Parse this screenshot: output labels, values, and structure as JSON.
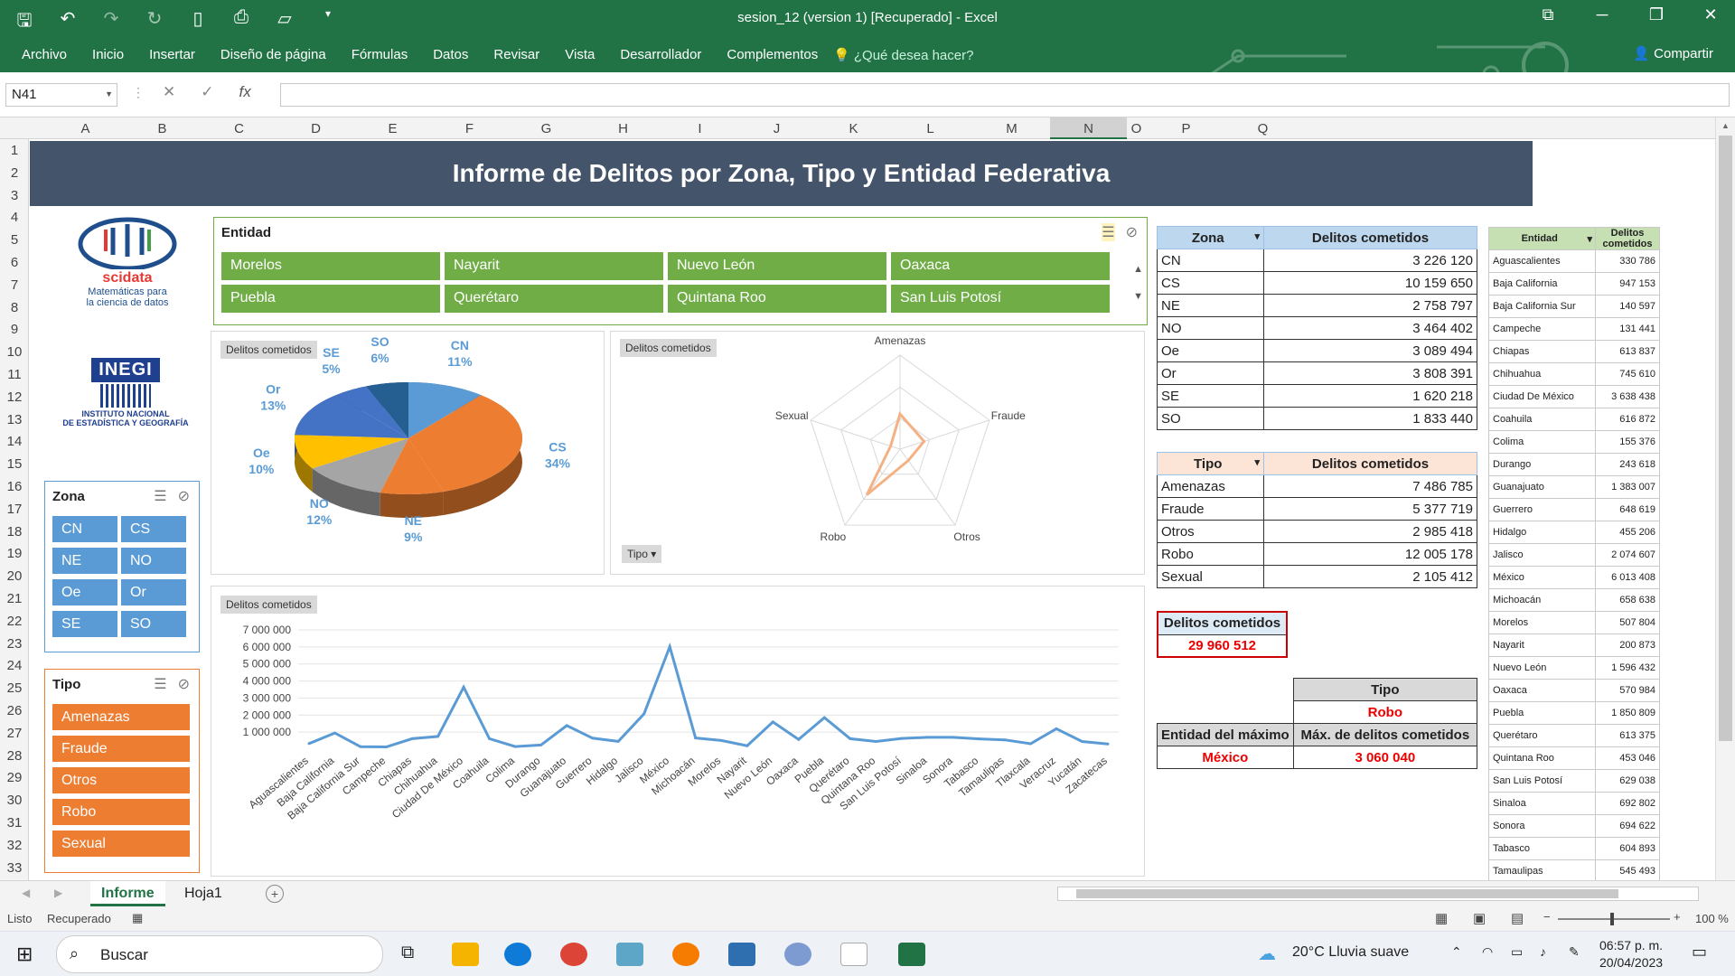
{
  "window": {
    "title": "sesion_12 (version 1) [Recuperado] - Excel"
  },
  "menu": {
    "items": [
      "Archivo",
      "Inicio",
      "Insertar",
      "Diseño de página",
      "Fórmulas",
      "Datos",
      "Revisar",
      "Vista",
      "Desarrollador",
      "Complementos"
    ],
    "tell_me": "¿Qué desea hacer?",
    "share": "Compartir"
  },
  "formula_bar": {
    "name_box": "N41",
    "fx": "fx",
    "value": ""
  },
  "columns": [
    "A",
    "B",
    "C",
    "D",
    "E",
    "F",
    "G",
    "H",
    "I",
    "J",
    "K",
    "L",
    "M",
    "N",
    "O",
    "P",
    "Q"
  ],
  "rows": [
    "1",
    "2",
    "3",
    "4",
    "5",
    "6",
    "7",
    "8",
    "9",
    "10",
    "11",
    "12",
    "13",
    "14",
    "15",
    "16",
    "17",
    "18",
    "19",
    "20",
    "21",
    "22",
    "23",
    "24",
    "25",
    "26",
    "27",
    "28",
    "29",
    "30",
    "31",
    "32",
    "33"
  ],
  "banner": {
    "title": "Informe de Delitos por Zona, Tipo y Entidad Federativa"
  },
  "logos": {
    "scidata_name": "scidata",
    "scidata_tagline_1": "Matemáticas para",
    "scidata_tagline_2": "la ciencia de datos",
    "inegi_name": "INEGI",
    "inegi_line_1": "INSTITUTO NACIONAL",
    "inegi_line_2": "DE ESTADÍSTICA Y GEOGRAFÍA"
  },
  "slicers": {
    "entidad": {
      "title": "Entidad",
      "items": [
        "Morelos",
        "Nayarit",
        "Nuevo León",
        "Oaxaca",
        "Puebla",
        "Querétaro",
        "Quintana Roo",
        "San Luis Potosí"
      ]
    },
    "zona": {
      "title": "Zona",
      "items": [
        "CN",
        "CS",
        "NE",
        "NO",
        "Oe",
        "Or",
        "SE",
        "SO"
      ]
    },
    "tipo": {
      "title": "Tipo",
      "items": [
        "Amenazas",
        "Fraude",
        "Otros",
        "Robo",
        "Sexual"
      ]
    }
  },
  "chart_labels": {
    "pie": "Delitos cometidos",
    "radar": "Delitos cometidos",
    "line": "Delitos cometidos",
    "radar_filter": "Tipo"
  },
  "chart_data": [
    {
      "type": "pie",
      "categories": [
        "CN",
        "CS",
        "NE",
        "NO",
        "Oe",
        "Or",
        "SE",
        "SO"
      ],
      "values": [
        11,
        34,
        9,
        12,
        10,
        13,
        5,
        6
      ],
      "labels": [
        "11%",
        "34%",
        "9%",
        "12%",
        "10%",
        "13%",
        "5%",
        "6%"
      ],
      "colors": [
        "#5b9bd5",
        "#ed7d31",
        "#ed7d31",
        "#a5a5a5",
        "#ffc000",
        "#4472c4",
        "#4472c4",
        "#255e91"
      ]
    },
    {
      "type": "radar",
      "categories": [
        "Amenazas",
        "Fraude",
        "Otros",
        "Robo",
        "Sexual"
      ],
      "values": [
        7486785,
        5377719,
        2985418,
        12005178,
        2105412
      ],
      "rmax": 20000000
    },
    {
      "type": "line",
      "categories": [
        "Aguascalientes",
        "Baja California",
        "Baja California Sur",
        "Campeche",
        "Chiapas",
        "Chihuahua",
        "Ciudad De México",
        "Coahuila",
        "Colima",
        "Durango",
        "Guanajuato",
        "Guerrero",
        "Hidalgo",
        "Jalisco",
        "México",
        "Michoacán",
        "Morelos",
        "Nayarit",
        "Nuevo León",
        "Oaxaca",
        "Puebla",
        "Querétaro",
        "Quintana Roo",
        "San Luis Potosí",
        "Sinaloa",
        "Sonora",
        "Tabasco",
        "Tamaulipas",
        "Tlaxcala",
        "Veracruz",
        "Yucatán",
        "Zacatecas"
      ],
      "values": [
        330786,
        947153,
        140597,
        131441,
        613837,
        745610,
        3638438,
        616872,
        155376,
        243618,
        1383007,
        648619,
        455206,
        2074607,
        6013408,
        658638,
        507804,
        200873,
        1596432,
        570984,
        1850809,
        613375,
        453046,
        629038,
        692802,
        694622,
        604893,
        545493,
        320000,
        1200000,
        450000,
        300000
      ],
      "ylim": [
        0,
        7000000
      ],
      "yticks": [
        "7 000 000",
        "6 000 000",
        "5 000 000",
        "4 000 000",
        "3 000 000",
        "2 000 000",
        "1 000 000"
      ]
    }
  ],
  "zona_table": {
    "headers": [
      "Zona",
      "Delitos cometidos"
    ],
    "rows": [
      [
        "CN",
        "3 226 120"
      ],
      [
        "CS",
        "10 159 650"
      ],
      [
        "NE",
        "2 758 797"
      ],
      [
        "NO",
        "3 464 402"
      ],
      [
        "Oe",
        "3 089 494"
      ],
      [
        "Or",
        "3 808 391"
      ],
      [
        "SE",
        "1 620 218"
      ],
      [
        "SO",
        "1 833 440"
      ]
    ]
  },
  "tipo_table": {
    "headers": [
      "Tipo",
      "Delitos cometidos"
    ],
    "rows": [
      [
        "Amenazas",
        "7 486 785"
      ],
      [
        "Fraude",
        "5 377 719"
      ],
      [
        "Otros",
        "2 985 418"
      ],
      [
        "Robo",
        "12 005 178"
      ],
      [
        "Sexual",
        "2 105 412"
      ]
    ]
  },
  "total": {
    "label": "Delitos cometidos",
    "value": "29 960 512"
  },
  "max_tipo": {
    "label": "Tipo",
    "value": "Robo"
  },
  "max_entidad": {
    "label_entidad": "Entidad del máximo",
    "label_max": "Máx. de delitos cometidos",
    "entidad": "México",
    "value": "3 060 040"
  },
  "entidad_table": {
    "headers": [
      "Entidad",
      "Delitos cometidos"
    ],
    "rows": [
      [
        "Aguascalientes",
        "330 786"
      ],
      [
        "Baja California",
        "947 153"
      ],
      [
        "Baja California Sur",
        "140 597"
      ],
      [
        "Campeche",
        "131 441"
      ],
      [
        "Chiapas",
        "613 837"
      ],
      [
        "Chihuahua",
        "745 610"
      ],
      [
        "Ciudad De México",
        "3 638 438"
      ],
      [
        "Coahuila",
        "616 872"
      ],
      [
        "Colima",
        "155 376"
      ],
      [
        "Durango",
        "243 618"
      ],
      [
        "Guanajuato",
        "1 383 007"
      ],
      [
        "Guerrero",
        "648 619"
      ],
      [
        "Hidalgo",
        "455 206"
      ],
      [
        "Jalisco",
        "2 074 607"
      ],
      [
        "México",
        "6 013 408"
      ],
      [
        "Michoacán",
        "658 638"
      ],
      [
        "Morelos",
        "507 804"
      ],
      [
        "Nayarit",
        "200 873"
      ],
      [
        "Nuevo León",
        "1 596 432"
      ],
      [
        "Oaxaca",
        "570 984"
      ],
      [
        "Puebla",
        "1 850 809"
      ],
      [
        "Querétaro",
        "613 375"
      ],
      [
        "Quintana Roo",
        "453 046"
      ],
      [
        "San Luis Potosí",
        "629 038"
      ],
      [
        "Sinaloa",
        "692 802"
      ],
      [
        "Sonora",
        "694 622"
      ],
      [
        "Tabasco",
        "604 893"
      ],
      [
        "Tamaulipas",
        "545 493"
      ]
    ]
  },
  "sheet_tabs": [
    "Informe",
    "Hoja1"
  ],
  "status": {
    "ready": "Listo",
    "recovered": "Recuperado",
    "zoom": "100 %"
  },
  "taskbar": {
    "search": "Buscar",
    "weather": "20°C  Lluvia suave",
    "time": "06:57 p. m.",
    "date": "20/04/2023"
  }
}
